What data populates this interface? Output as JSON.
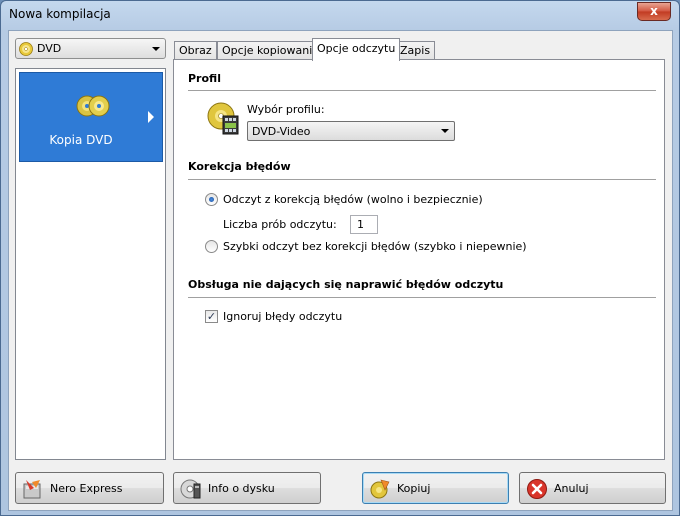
{
  "window": {
    "title": "Nowa kompilacja",
    "close_glyph": "x"
  },
  "left": {
    "media_combo_value": "DVD",
    "tile_label": "Kopia DVD"
  },
  "tabs": [
    {
      "label": "Obraz"
    },
    {
      "label": "Opcje kopiowania"
    },
    {
      "label": "Opcje odczytu",
      "active": true
    },
    {
      "label": "Zapis"
    }
  ],
  "panel": {
    "profile_section": "Profil",
    "profile_label": "Wybór profilu:",
    "profile_value": "DVD-Video",
    "error_section": "Korekcja błędów",
    "radio_correction_label": "Odczyt z korekcją błędów (wolno i bezpiecznie)",
    "retries_label": "Liczba prób odczytu:",
    "retries_value": "1",
    "radio_fast_label": "Szybki odczyt bez korekcji błędów (szybko i niepewnie)",
    "unrecoverable_section": "Obsługa nie dających się naprawić błędów odczytu",
    "ignore_errors_label": "Ignoruj błędy odczytu",
    "ignore_errors_checked": true,
    "checkbox_glyph": "✓"
  },
  "buttons": {
    "nero_express": "Nero Express",
    "disc_info": "Info o dysku",
    "copy": "Kopiuj",
    "cancel": "Anuluj"
  },
  "colors": {
    "tile_bg": "#2f7bd6",
    "title_bar": "#b6cbe4",
    "close_button": "#c13a22"
  },
  "icons": [
    "dvd-disc-icon",
    "profile-disc-icon",
    "nero-express-icon",
    "disc-info-icon",
    "copy-icon",
    "cancel-icon",
    "chevron-down-icon",
    "chevron-right-icon"
  ]
}
